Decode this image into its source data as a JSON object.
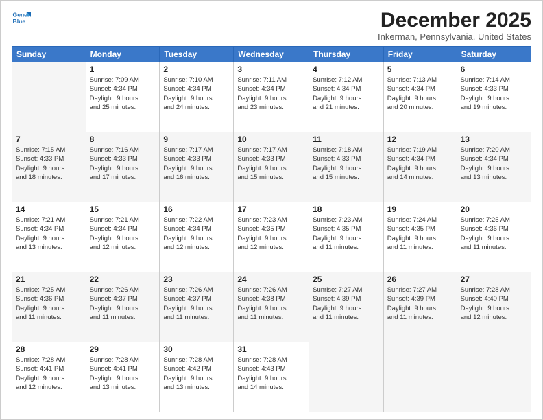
{
  "logo": {
    "line1": "General",
    "line2": "Blue"
  },
  "title": "December 2025",
  "subtitle": "Inkerman, Pennsylvania, United States",
  "headers": [
    "Sunday",
    "Monday",
    "Tuesday",
    "Wednesday",
    "Thursday",
    "Friday",
    "Saturday"
  ],
  "weeks": [
    [
      {
        "day": "",
        "info": ""
      },
      {
        "day": "1",
        "info": "Sunrise: 7:09 AM\nSunset: 4:34 PM\nDaylight: 9 hours\nand 25 minutes."
      },
      {
        "day": "2",
        "info": "Sunrise: 7:10 AM\nSunset: 4:34 PM\nDaylight: 9 hours\nand 24 minutes."
      },
      {
        "day": "3",
        "info": "Sunrise: 7:11 AM\nSunset: 4:34 PM\nDaylight: 9 hours\nand 23 minutes."
      },
      {
        "day": "4",
        "info": "Sunrise: 7:12 AM\nSunset: 4:34 PM\nDaylight: 9 hours\nand 21 minutes."
      },
      {
        "day": "5",
        "info": "Sunrise: 7:13 AM\nSunset: 4:34 PM\nDaylight: 9 hours\nand 20 minutes."
      },
      {
        "day": "6",
        "info": "Sunrise: 7:14 AM\nSunset: 4:33 PM\nDaylight: 9 hours\nand 19 minutes."
      }
    ],
    [
      {
        "day": "7",
        "info": "Sunrise: 7:15 AM\nSunset: 4:33 PM\nDaylight: 9 hours\nand 18 minutes."
      },
      {
        "day": "8",
        "info": "Sunrise: 7:16 AM\nSunset: 4:33 PM\nDaylight: 9 hours\nand 17 minutes."
      },
      {
        "day": "9",
        "info": "Sunrise: 7:17 AM\nSunset: 4:33 PM\nDaylight: 9 hours\nand 16 minutes."
      },
      {
        "day": "10",
        "info": "Sunrise: 7:17 AM\nSunset: 4:33 PM\nDaylight: 9 hours\nand 15 minutes."
      },
      {
        "day": "11",
        "info": "Sunrise: 7:18 AM\nSunset: 4:33 PM\nDaylight: 9 hours\nand 15 minutes."
      },
      {
        "day": "12",
        "info": "Sunrise: 7:19 AM\nSunset: 4:34 PM\nDaylight: 9 hours\nand 14 minutes."
      },
      {
        "day": "13",
        "info": "Sunrise: 7:20 AM\nSunset: 4:34 PM\nDaylight: 9 hours\nand 13 minutes."
      }
    ],
    [
      {
        "day": "14",
        "info": "Sunrise: 7:21 AM\nSunset: 4:34 PM\nDaylight: 9 hours\nand 13 minutes."
      },
      {
        "day": "15",
        "info": "Sunrise: 7:21 AM\nSunset: 4:34 PM\nDaylight: 9 hours\nand 12 minutes."
      },
      {
        "day": "16",
        "info": "Sunrise: 7:22 AM\nSunset: 4:34 PM\nDaylight: 9 hours\nand 12 minutes."
      },
      {
        "day": "17",
        "info": "Sunrise: 7:23 AM\nSunset: 4:35 PM\nDaylight: 9 hours\nand 12 minutes."
      },
      {
        "day": "18",
        "info": "Sunrise: 7:23 AM\nSunset: 4:35 PM\nDaylight: 9 hours\nand 11 minutes."
      },
      {
        "day": "19",
        "info": "Sunrise: 7:24 AM\nSunset: 4:35 PM\nDaylight: 9 hours\nand 11 minutes."
      },
      {
        "day": "20",
        "info": "Sunrise: 7:25 AM\nSunset: 4:36 PM\nDaylight: 9 hours\nand 11 minutes."
      }
    ],
    [
      {
        "day": "21",
        "info": "Sunrise: 7:25 AM\nSunset: 4:36 PM\nDaylight: 9 hours\nand 11 minutes."
      },
      {
        "day": "22",
        "info": "Sunrise: 7:26 AM\nSunset: 4:37 PM\nDaylight: 9 hours\nand 11 minutes."
      },
      {
        "day": "23",
        "info": "Sunrise: 7:26 AM\nSunset: 4:37 PM\nDaylight: 9 hours\nand 11 minutes."
      },
      {
        "day": "24",
        "info": "Sunrise: 7:26 AM\nSunset: 4:38 PM\nDaylight: 9 hours\nand 11 minutes."
      },
      {
        "day": "25",
        "info": "Sunrise: 7:27 AM\nSunset: 4:39 PM\nDaylight: 9 hours\nand 11 minutes."
      },
      {
        "day": "26",
        "info": "Sunrise: 7:27 AM\nSunset: 4:39 PM\nDaylight: 9 hours\nand 11 minutes."
      },
      {
        "day": "27",
        "info": "Sunrise: 7:28 AM\nSunset: 4:40 PM\nDaylight: 9 hours\nand 12 minutes."
      }
    ],
    [
      {
        "day": "28",
        "info": "Sunrise: 7:28 AM\nSunset: 4:41 PM\nDaylight: 9 hours\nand 12 minutes."
      },
      {
        "day": "29",
        "info": "Sunrise: 7:28 AM\nSunset: 4:41 PM\nDaylight: 9 hours\nand 13 minutes."
      },
      {
        "day": "30",
        "info": "Sunrise: 7:28 AM\nSunset: 4:42 PM\nDaylight: 9 hours\nand 13 minutes."
      },
      {
        "day": "31",
        "info": "Sunrise: 7:28 AM\nSunset: 4:43 PM\nDaylight: 9 hours\nand 14 minutes."
      },
      {
        "day": "",
        "info": ""
      },
      {
        "day": "",
        "info": ""
      },
      {
        "day": "",
        "info": ""
      }
    ]
  ]
}
